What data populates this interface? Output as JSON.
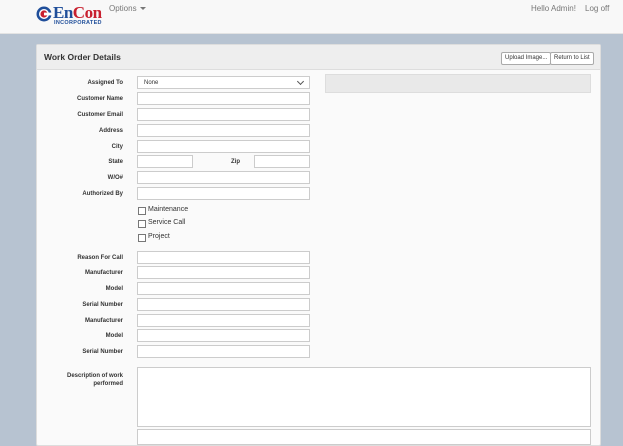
{
  "nav": {
    "logo_text_a": "En",
    "logo_text_b": "Con",
    "logo_sub": "INCORPORATED",
    "options_label": "Options",
    "hello_label": "Hello Admin!",
    "logoff_label": "Log off"
  },
  "panel": {
    "title": "Work Order Details",
    "upload_label": "Upload Image...",
    "return_label": "Return to List"
  },
  "form": {
    "assigned_to_label": "Assigned To",
    "assigned_to_value": "None",
    "customer_name_label": "Customer Name",
    "customer_email_label": "Customer Email",
    "address_label": "Address",
    "city_label": "City",
    "state_label": "State",
    "zip_label": "Zip",
    "wo_label": "W/O#",
    "authorized_by_label": "Authorized By",
    "checkboxes": [
      "Maintenance",
      "Service Call",
      "Project"
    ],
    "reason_label": "Reason For Call",
    "manufacturer1_label": "Manufacturer",
    "model1_label": "Model",
    "serial1_label": "Serial Number",
    "manufacturer2_label": "Manufacturer",
    "model2_label": "Model",
    "serial2_label": "Serial Number",
    "description_label_1": "Description of work",
    "description_label_2": "performed"
  },
  "colors": {
    "brand_blue": "#1f4e9a",
    "brand_red": "#c8202f",
    "page_background": "#b7c3d1"
  }
}
